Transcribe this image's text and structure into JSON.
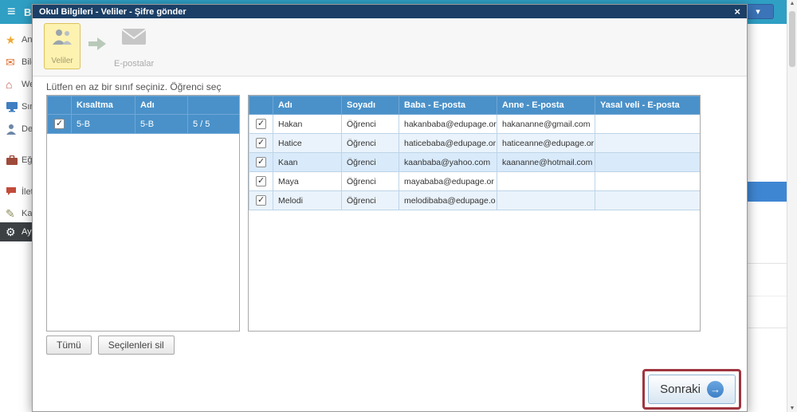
{
  "topbar": {
    "menu_label": "Ba"
  },
  "icons": {
    "menu": "≡",
    "star": "★",
    "mail": "✉",
    "home": "⌂",
    "pen": "✎",
    "gear": "⚙",
    "close": "×",
    "caret_down": "▾",
    "scroll_up": "▲",
    "scroll_down": "▼",
    "arrow_right": "→"
  },
  "sidebar": {
    "items": [
      {
        "label": "Ana",
        "icon": "star-icon"
      },
      {
        "label": "Bild",
        "icon": "mail-icon"
      },
      {
        "label": "Wel",
        "icon": "home-icon"
      },
      {
        "label": "Sını",
        "icon": "monitor-icon"
      },
      {
        "label": "Dev",
        "icon": "person-icon"
      },
      {
        "label": "Eğit",
        "icon": "briefcase-icon"
      },
      {
        "label": "İleti",
        "icon": "chat-icon"
      },
      {
        "label": "Kay",
        "icon": "pen-icon"
      },
      {
        "label": "Aya",
        "icon": "gear-icon",
        "active": true
      }
    ]
  },
  "modal": {
    "title": "Okul Bilgileri - Veliler - Şifre gönder",
    "wizard": {
      "steps": [
        {
          "label": "Veliler",
          "state": "active"
        },
        {
          "label": "E-postalar",
          "state": "disabled"
        }
      ]
    },
    "instruction": "Lütfen en az bir sınıf seçiniz. Öğrenci seç",
    "class_table": {
      "headers": [
        "Kısaltma",
        "Adı",
        ""
      ],
      "rows": [
        {
          "checked": true,
          "kisaltma": "5-B",
          "adi": "5-B",
          "sayi": "5 / 5"
        }
      ]
    },
    "student_table": {
      "headers": [
        "Adı",
        "Soyadı",
        "Baba - E-posta",
        "Anne - E-posta",
        "Yasal veli - E-posta"
      ],
      "rows": [
        {
          "checked": true,
          "adi": "Hakan",
          "soyadi": "Öğrenci",
          "baba_eposta": "hakanbaba@edupage.or",
          "anne_eposta": "hakananne@gmail.com",
          "yasal_eposta": ""
        },
        {
          "checked": true,
          "adi": "Hatice",
          "soyadi": "Öğrenci",
          "baba_eposta": "haticebaba@edupage.or",
          "anne_eposta": "haticeanne@edupage.or",
          "yasal_eposta": ""
        },
        {
          "checked": true,
          "adi": "Kaan",
          "soyadi": "Öğrenci",
          "baba_eposta": "kaanbaba@yahoo.com",
          "anne_eposta": "kaananne@hotmail.com",
          "yasal_eposta": ""
        },
        {
          "checked": true,
          "adi": "Maya",
          "soyadi": "Öğrenci",
          "baba_eposta": "mayababa@edupage.or",
          "anne_eposta": "",
          "yasal_eposta": ""
        },
        {
          "checked": true,
          "adi": "Melodi",
          "soyadi": "Öğrenci",
          "baba_eposta": "melodibaba@edupage.o",
          "anne_eposta": "",
          "yasal_eposta": ""
        }
      ]
    },
    "buttons": {
      "all": "Tümü",
      "delete_selected": "Seçilenleri sil",
      "next": "Sonraki"
    }
  },
  "colors": {
    "titlebar": "#1b3f66",
    "table_header_blue": "#4a91c9",
    "topbar_teal": "#2f9fc4",
    "annotation_red": "#a03540",
    "step_active_bg": "#fdf2b0"
  }
}
